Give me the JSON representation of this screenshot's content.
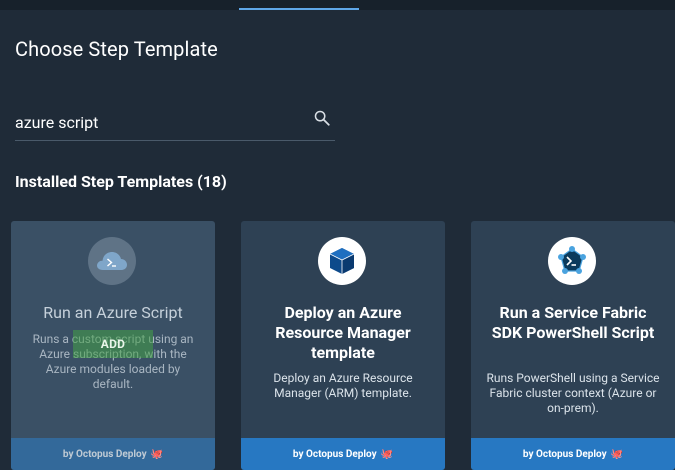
{
  "page": {
    "title": "Choose Step Template"
  },
  "search": {
    "value": "azure script",
    "placeholder": ""
  },
  "section": {
    "title": "Installed Step Templates (18)"
  },
  "cards": [
    {
      "name": "Run an Azure Script",
      "description": "Runs a custom script using an Azure subscription, with the Azure modules loaded by default.",
      "footer": "by Octopus Deploy",
      "action": "ADD",
      "icon": "azure-cloud-powershell-icon"
    },
    {
      "name": "Deploy an Azure Resource Manager template",
      "description": "Deploy an Azure Resource Manager (ARM) template.",
      "footer": "by Octopus Deploy",
      "icon": "azure-resource-cube-icon"
    },
    {
      "name": "Run a Service Fabric SDK PowerShell Script",
      "description": "Runs PowerShell using a Service Fabric cluster context (Azure or on-prem).",
      "footer": "by Octopus Deploy",
      "icon": "service-fabric-powershell-icon"
    }
  ],
  "colors": {
    "background": "#1f2b38",
    "card": "#2e4154",
    "card_hover": "#3a5065",
    "footer": "#2778c2",
    "accent": "#5fa7e8",
    "add_button": "#43a047"
  }
}
